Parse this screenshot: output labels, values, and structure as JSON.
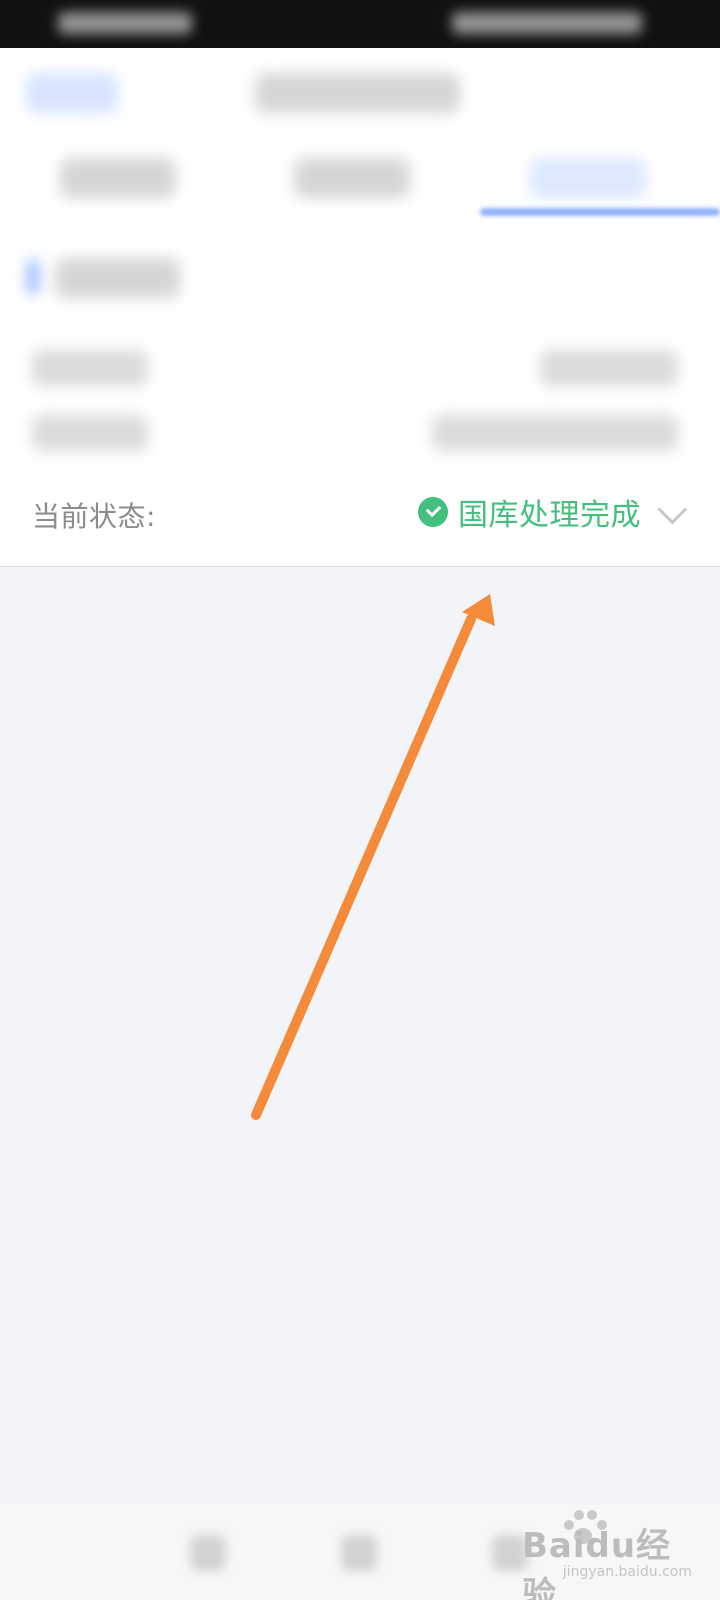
{
  "status": {
    "label": "当前状态:",
    "value": "国库处理完成"
  },
  "watermark": {
    "main": "Baidu经验",
    "sub": "jingyan.baidu.com"
  },
  "annotation": {
    "color": "#f38b3b",
    "type": "arrow"
  },
  "colors": {
    "success": "#43c07e",
    "accent": "#6b97ff",
    "muted_text": "#8b8b90"
  },
  "icons": {
    "status": "check-circle-icon",
    "dropdown": "chevron-down-icon",
    "nav_back": "nav-back-icon",
    "nav_home": "nav-home-icon",
    "nav_recent": "nav-recent-icon"
  }
}
